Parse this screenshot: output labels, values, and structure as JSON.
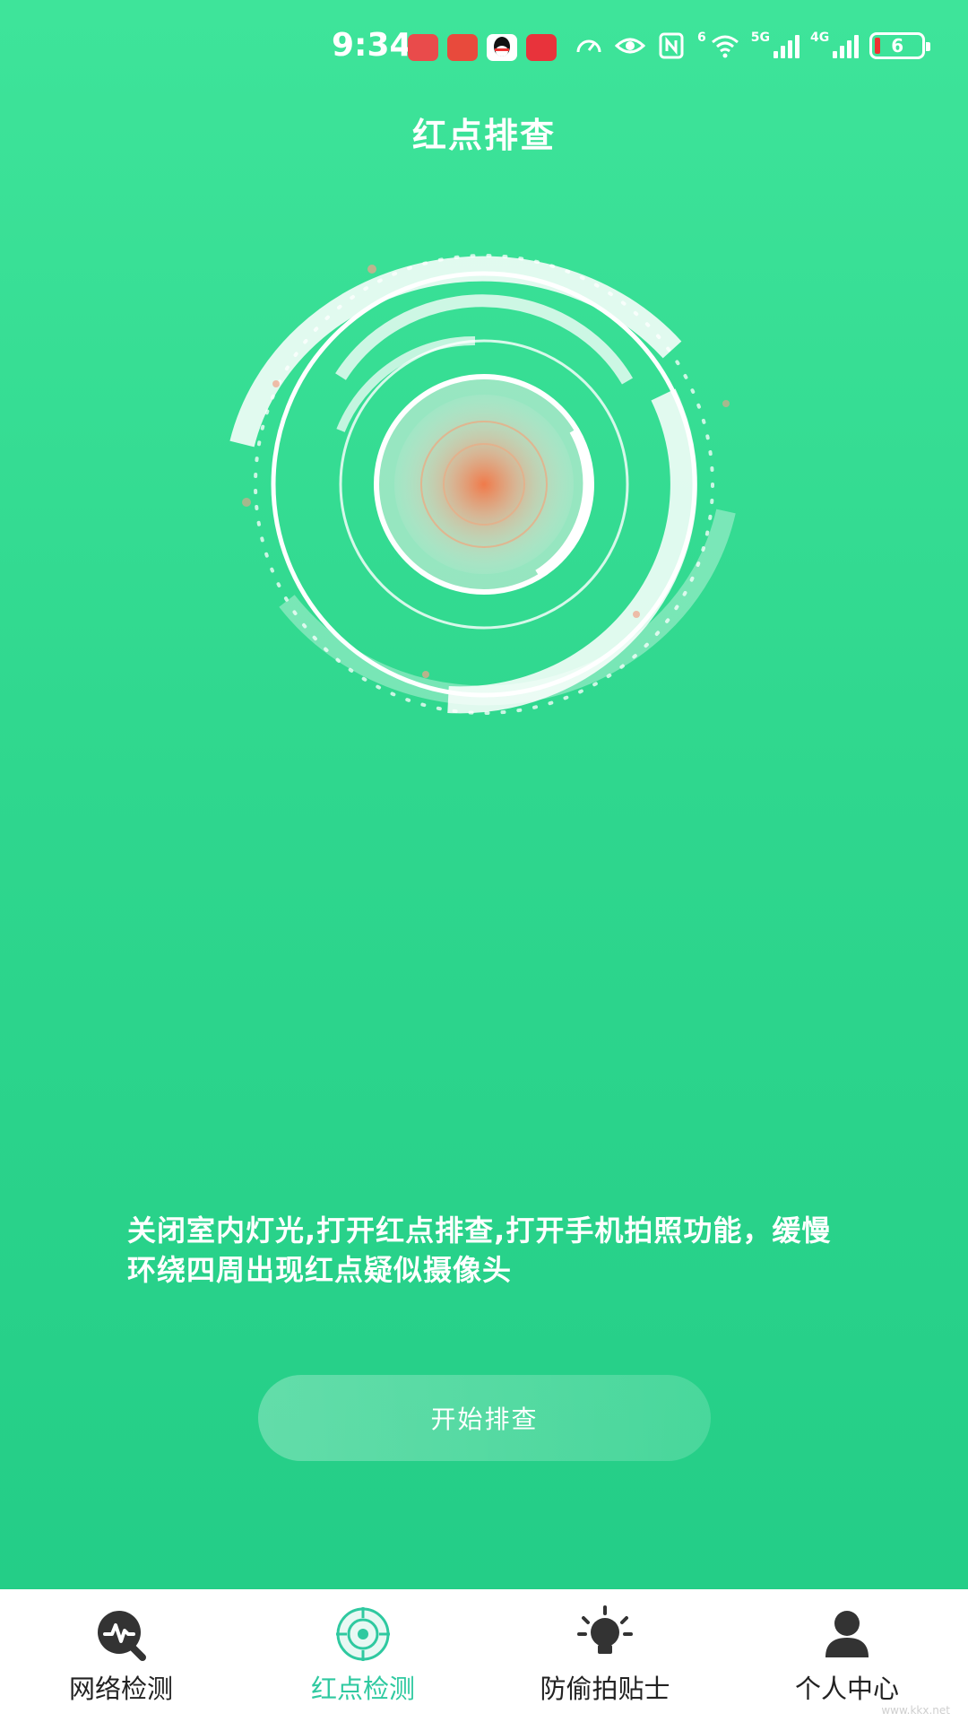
{
  "status_bar": {
    "time": "9:34",
    "network_1": "5G",
    "network_2": "4G",
    "wifi_badge": "6",
    "battery": "6"
  },
  "page": {
    "title": "红点排查",
    "instruction": "关闭室内灯光,打开红点排查,打开手机拍照功能，缓慢环绕四周出现红点疑似摄像头",
    "start_button": "开始排查"
  },
  "nav": {
    "items": [
      {
        "label": "网络检测",
        "icon": "network-check-icon",
        "active": false
      },
      {
        "label": "红点检测",
        "icon": "red-dot-target-icon",
        "active": true
      },
      {
        "label": "防偷拍贴士",
        "icon": "tips-lightbulb-icon",
        "active": false
      },
      {
        "label": "个人中心",
        "icon": "user-icon",
        "active": false
      }
    ]
  },
  "colors": {
    "background_top": "#3ee49a",
    "background_bottom": "#22cc86",
    "active_tab": "#2fc9a0",
    "center_dot": "#f07a4a"
  },
  "watermark": "www.kkx.net"
}
